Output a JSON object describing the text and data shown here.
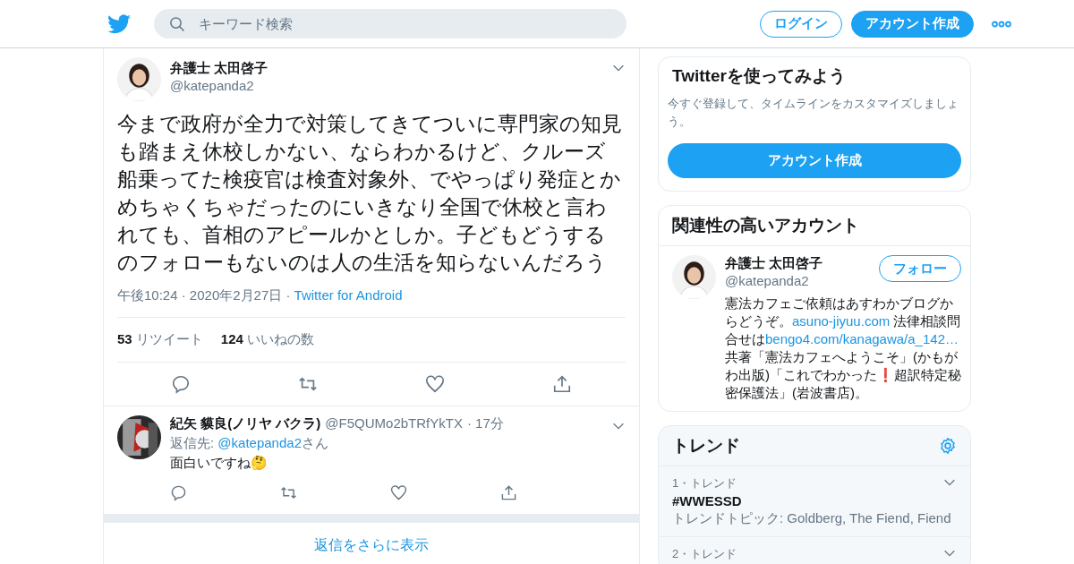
{
  "header": {
    "search": {
      "placeholder": "キーワード検索"
    },
    "login": "ログイン",
    "signup": "アカウント作成"
  },
  "tweet": {
    "name": "弁護士 太田啓子",
    "handle": "@katepanda2",
    "text": "今まで政府が全力で対策してきてついに専門家の知見も踏まえ休校しかない、ならわかるけど、クルーズ船乗ってた検疫官は検査対象外、でやっぱり発症とかめちゃくちゃだったのにいきなり全国で休校と言われても、首相のアピールかとしか。子どもどうするのフォローもないのは人の生活を知らないんだろう",
    "time": "午後10:24 · 2020年2月27日 ·",
    "source": "Twitter for Android",
    "stats": [
      {
        "count": "53",
        "label": "リツイート"
      },
      {
        "count": "124",
        "label": "いいねの数"
      }
    ]
  },
  "reply": {
    "name": "紀矢 貘良(ノリヤ バクラ)",
    "handle": "@F5QUMo2bTRfYkTX",
    "time": "· 17分",
    "reply_to_prefix": "返信先: ",
    "reply_to": "@katepanda2",
    "reply_to_suffix": "さん",
    "text": "面白いですね🤔"
  },
  "more_replies": "返信をさらに表示",
  "signup_card": {
    "title": "Twitterを使ってみよう",
    "text": "今すぐ登録して、タイムラインをカスタマイズしましょう。",
    "button": "アカウント作成"
  },
  "related": {
    "title": "関連性の高いアカウント",
    "name": "弁護士 太田啓子",
    "handle": "@katepanda2",
    "follow": "フォロー",
    "bio": [
      {
        "kind": "text",
        "text": "憲法カフェご依頼はあすわかブログからどうぞ。"
      },
      {
        "kind": "link",
        "text": "asuno-jiyuu.com"
      },
      {
        "kind": "text",
        "text": " 法律相談問合せは"
      },
      {
        "kind": "link",
        "text": "bengo4.com/kanagawa/a_142…"
      },
      {
        "kind": "text",
        "text": " 共著「憲法カフェへようこそ」(かもがわ出版)「これでわかった❗超訳特定秘密保護法」(岩波書店)。"
      }
    ]
  },
  "trends": {
    "title": "トレンド",
    "items": [
      {
        "rank": "1・トレンド",
        "name": "#WWESSD",
        "topic": "トレンドトピック: Goldberg, The Fiend, Fiend"
      },
      {
        "rank": "2・トレンド"
      }
    ]
  }
}
